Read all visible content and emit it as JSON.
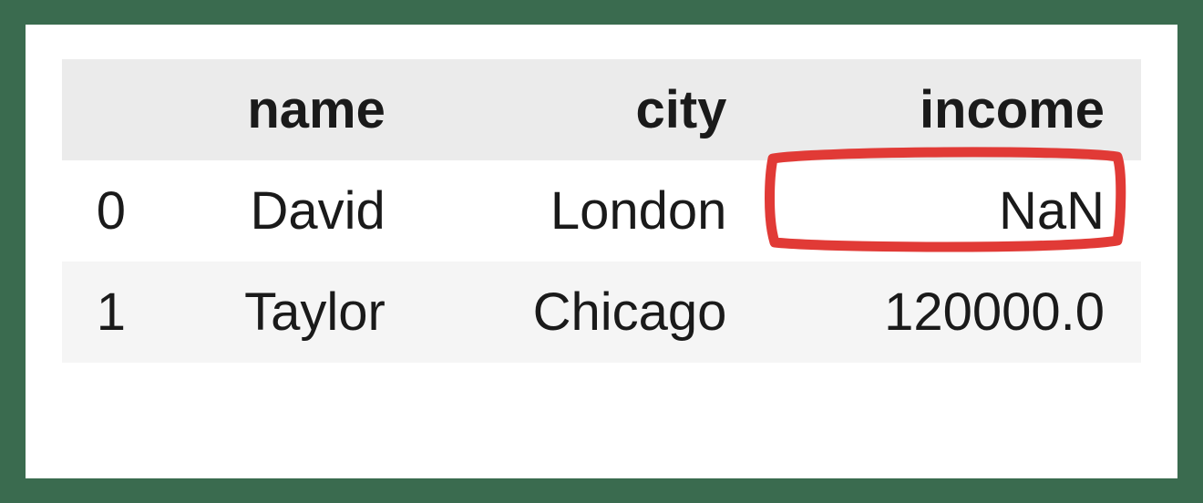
{
  "table": {
    "columns": [
      "",
      "name",
      "city",
      "income"
    ],
    "rows": [
      {
        "index": "0",
        "name": "David",
        "city": "London",
        "income": "NaN"
      },
      {
        "index": "1",
        "name": "Taylor",
        "city": "Chicago",
        "income": "120000.0"
      }
    ],
    "highlight": {
      "row": 0,
      "col": "income"
    }
  }
}
